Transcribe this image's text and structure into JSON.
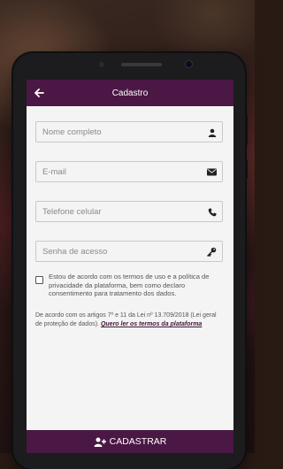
{
  "appbar": {
    "title": "Cadastro"
  },
  "form": {
    "name_placeholder": "Nome completo",
    "email_placeholder": "E-mail",
    "phone_placeholder": "Telefone celular",
    "password_placeholder": "Senha de acesso"
  },
  "terms": {
    "consent_text": "Estou de acordo com os termos de uso e a política de privacidade da plataforma, bem como declaro consentimento para tratamento dos dados.",
    "legal_text": "De acordo com os artigos 7º e 11 da Lei nº 13.709/2018 (Lei geral de proteção de dados).",
    "legal_link": "Quero ler os termos da plataforma"
  },
  "submit": {
    "label": "CADASTRAR"
  },
  "colors": {
    "primary": "#4b1745",
    "screen_bg": "#f4f4f4",
    "field_border": "#c9c9c9"
  },
  "icons": {
    "back": "arrow-left-icon",
    "name": "user-icon",
    "email": "envelope-icon",
    "phone": "phone-icon",
    "password": "key-icon",
    "submit": "user-plus-icon"
  }
}
